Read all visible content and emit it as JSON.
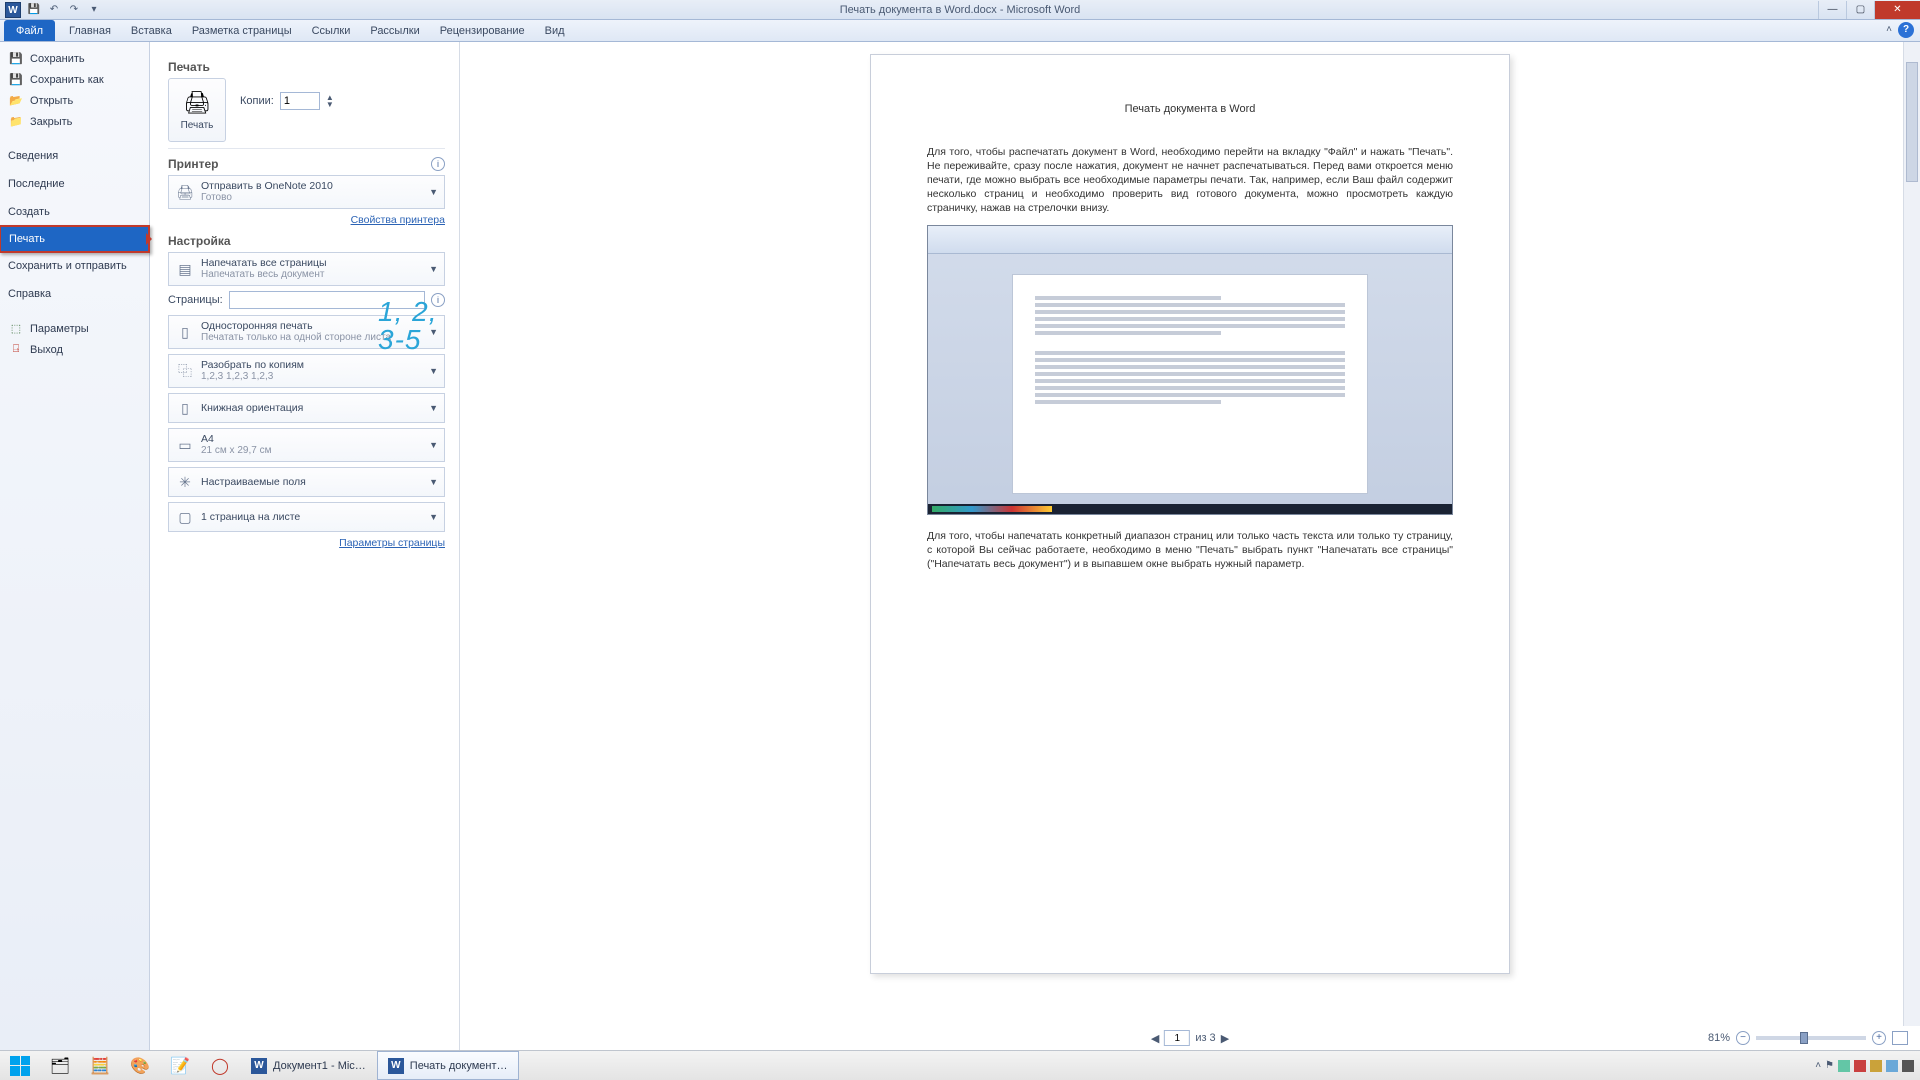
{
  "title": "Печать документа в Word.docx - Microsoft Word",
  "ribbon": {
    "file": "Файл",
    "tabs": [
      "Главная",
      "Вставка",
      "Разметка страницы",
      "Ссылки",
      "Рассылки",
      "Рецензирование",
      "Вид"
    ]
  },
  "sidebar": {
    "save": "Сохранить",
    "save_as": "Сохранить как",
    "open": "Открыть",
    "close": "Закрыть",
    "info": "Сведения",
    "recent": "Последние",
    "new": "Создать",
    "print": "Печать",
    "share": "Сохранить и отправить",
    "help": "Справка",
    "options": "Параметры",
    "exit": "Выход"
  },
  "settings": {
    "print_head": "Печать",
    "print_btn": "Печать",
    "copies_label": "Копии:",
    "copies_value": "1",
    "printer_head": "Принтер",
    "printer_name": "Отправить в OneNote 2010",
    "printer_status": "Готово",
    "printer_props": "Свойства принтера",
    "setup_head": "Настройка",
    "range_title": "Напечатать все страницы",
    "range_sub": "Напечатать весь документ",
    "pages_label": "Страницы:",
    "pages_ghost": "1, 2, 3-5",
    "side_title": "Односторонняя печать",
    "side_sub": "Печатать только на одной стороне листа",
    "collate_title": "Разобрать по копиям",
    "collate_sub": "1,2,3    1,2,3    1,2,3",
    "orient": "Книжная ориентация",
    "paper_title": "A4",
    "paper_sub": "21 см x 29,7 см",
    "margins": "Настраиваемые поля",
    "ppsheet": "1 страница на листе",
    "page_params": "Параметры страницы"
  },
  "preview": {
    "doc_title": "Печать документа в Word",
    "p1": "Для того, чтобы распечатать документ в Word, необходимо перейти на вкладку \"Файл\" и нажать \"Печать\". Не переживайте, сразу после нажатия, документ не начнет распечатываться. Перед вами откроется меню печати, где можно выбрать все необходимые параметры печати. Так, например, если Ваш файл содержит несколько страниц и необходимо проверить вид готового документа, можно просмотреть каждую страничку, нажав на стрелочки внизу.",
    "p2": "Для того, чтобы напечатать конкретный диапазон страниц или только часть текста или только ту страницу, с которой Вы сейчас работаете, необходимо в меню \"Печать\" выбрать пункт \"Напечатать все страницы\" (\"Напечатать весь документ\") и в выпавшем окне выбрать нужный параметр.",
    "page_current": "1",
    "page_of": "из 3",
    "zoom": "81%"
  },
  "taskbar": {
    "app1": "Документ1 - Mic…",
    "app2": "Печать документ…"
  }
}
